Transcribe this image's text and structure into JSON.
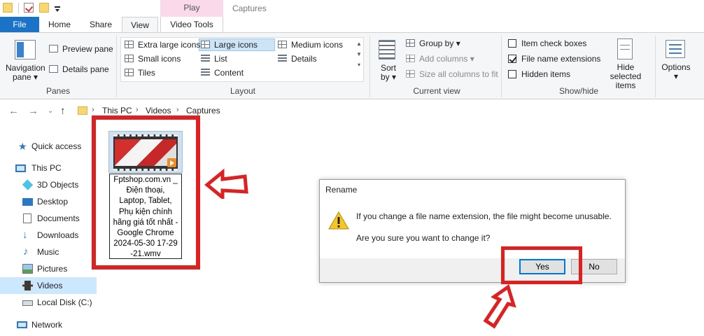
{
  "window": {
    "contextual_tab": "Play",
    "title": "Captures"
  },
  "tabs": {
    "file": "File",
    "home": "Home",
    "share": "Share",
    "view": "View",
    "video_tools": "Video Tools"
  },
  "ribbon": {
    "panes": {
      "navigation_pane": "Navigation\npane ▾",
      "preview_pane": "Preview pane",
      "details_pane": "Details pane",
      "label": "Panes"
    },
    "layout": {
      "extra_large_icons": "Extra large icons",
      "large_icons": "Large icons",
      "medium_icons": "Medium icons",
      "small_icons": "Small icons",
      "list": "List",
      "details": "Details",
      "tiles": "Tiles",
      "content": "Content",
      "label": "Layout",
      "selected": "Large icons"
    },
    "current_view": {
      "sort_by": "Sort\nby ▾",
      "group_by": "Group by ▾",
      "add_columns": "Add columns ▾",
      "size_all_columns": "Size all columns to fit",
      "label": "Current view"
    },
    "show_hide": {
      "item_check_boxes": "Item check boxes",
      "file_name_extensions": "File name extensions",
      "hidden_items": "Hidden items",
      "hide_selected_items": "Hide selected\nitems",
      "label": "Show/hide",
      "item_check_boxes_checked": false,
      "file_name_extensions_checked": true,
      "hidden_items_checked": false
    },
    "options": "Options\n▾"
  },
  "address": {
    "crumbs": [
      "This PC",
      "Videos",
      "Captures"
    ]
  },
  "nav": {
    "items": [
      {
        "label": "Quick access",
        "icon": "star-icon"
      },
      {
        "label": "This PC",
        "icon": "computer-icon"
      },
      {
        "label": "3D Objects",
        "icon": "cube-icon"
      },
      {
        "label": "Desktop",
        "icon": "desktop-icon"
      },
      {
        "label": "Documents",
        "icon": "documents-icon"
      },
      {
        "label": "Downloads",
        "icon": "download-icon"
      },
      {
        "label": "Music",
        "icon": "music-icon"
      },
      {
        "label": "Pictures",
        "icon": "pictures-icon"
      },
      {
        "label": "Videos",
        "icon": "videos-icon"
      },
      {
        "label": "Local Disk (C:)",
        "icon": "disk-icon"
      },
      {
        "label": "Network",
        "icon": "network-icon"
      }
    ],
    "selected": "Videos"
  },
  "file": {
    "name": "Fptshop.com.vn _\nĐiện thoại,\nLaptop, Tablet,\nPhụ kiện chính\nhãng giá tốt nhất -\nGoogle Chrome\n2024-05-30 17-29\n-21.wmv"
  },
  "dialog": {
    "title": "Rename",
    "message": "If you change a file name extension, the file might become unusable.",
    "question": "Are you sure you want to change it?",
    "yes": "Yes",
    "no": "No"
  },
  "colors": {
    "accent": "#1a73c6",
    "highlight": "#e02020",
    "selection": "#cce8ff",
    "contextual_tab": "#f9d9ea"
  }
}
